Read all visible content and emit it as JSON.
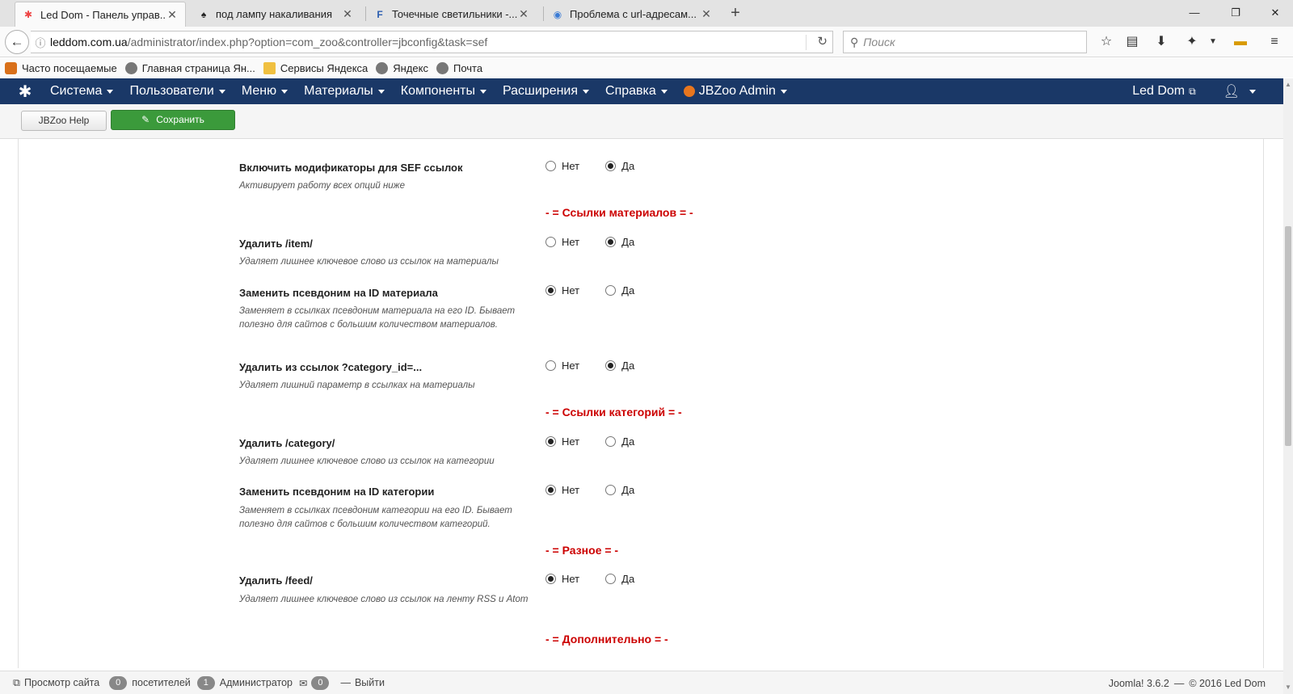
{
  "browser": {
    "tabs": [
      {
        "title": "Led Dom - Панель управ...",
        "active": true,
        "icon": "joomla-icon"
      },
      {
        "title": "под лампу накаливания",
        "active": false,
        "icon": "lamp-icon"
      },
      {
        "title": "Точечные светильники -...",
        "active": false,
        "icon": "f-site-icon"
      },
      {
        "title": "Проблема с url-адресам...",
        "active": false,
        "icon": "globe-icon"
      }
    ],
    "url_host": "leddom.com.ua",
    "url_path": "/administrator/index.php?option=com_zoo&controller=jbconfig&task=sef",
    "search_placeholder": "Поиск",
    "bookmarks": [
      {
        "label": "Часто посещаемые",
        "icon": "firefox-icon"
      },
      {
        "label": "Главная страница Ян...",
        "icon": "globe-icon"
      },
      {
        "label": "Сервисы Яндекса",
        "icon": "folder-icon"
      },
      {
        "label": "Яндекс",
        "icon": "globe-icon"
      },
      {
        "label": "Почта",
        "icon": "globe-icon"
      }
    ]
  },
  "admin": {
    "menu": [
      {
        "label": "Система"
      },
      {
        "label": "Пользователи"
      },
      {
        "label": "Меню"
      },
      {
        "label": "Материалы"
      },
      {
        "label": "Компоненты"
      },
      {
        "label": "Расширения"
      },
      {
        "label": "Справка"
      },
      {
        "label": "JBZoo Admin"
      }
    ],
    "site_link": "Led Dom",
    "toolbar": {
      "help_label": "JBZoo Help",
      "save_label": "Сохранить"
    }
  },
  "options": {
    "no_label": "Нет",
    "yes_label": "Да",
    "enable_sef": {
      "label": "Включить модификаторы для SEF ссылок",
      "desc": "Активирует работу всех опций ниже",
      "value": "yes"
    },
    "section_items": "- = Ссылки материалов = -",
    "remove_item": {
      "label": "Удалить /item/",
      "desc": "Удаляет лишнее ключевое слово из ссылок на материалы",
      "value": "yes"
    },
    "alias_item_id": {
      "label": "Заменить псевдоним на ID материала",
      "desc": "Заменяет в ссылках псевдоним материала на его ID. Бывает полезно для сайтов с большим количеством материалов.",
      "value": "no"
    },
    "remove_category_id": {
      "label": "Удалить из ссылок ?category_id=...",
      "desc": "Удаляет лишний параметр в ссылках на материалы",
      "value": "yes"
    },
    "section_categories": "- = Ссылки категорий = -",
    "remove_category": {
      "label": "Удалить /category/",
      "desc": "Удаляет лишнее ключевое слово из ссылок на категории",
      "value": "no"
    },
    "alias_category_id": {
      "label": "Заменить псевдоним на ID категории",
      "desc": "Заменяет в ссылках псевдоним категории на его ID. Бывает полезно для сайтов с большим количеством категорий.",
      "value": "no"
    },
    "section_misc": "- = Разное = -",
    "remove_feed": {
      "label": "Удалить /feed/",
      "desc": "Удаляет лишнее ключевое слово из ссылок на ленту RSS и Atom",
      "value": "no"
    },
    "section_extra": "- = Дополнительно = -"
  },
  "status": {
    "view_site": "Просмотр сайта",
    "visitors_count": "0",
    "visitors_label": "посетителей",
    "admins_count": "1",
    "admins_label": "Администратор",
    "messages_count": "0",
    "logout": "Выйти",
    "version": "Joomla! 3.6.2",
    "dash": "—",
    "copyright": "© 2016 Led Dom"
  },
  "colors": {
    "header_bg": "#1a3867",
    "save_green": "#3b9a3b",
    "section_red": "#cc0000"
  }
}
